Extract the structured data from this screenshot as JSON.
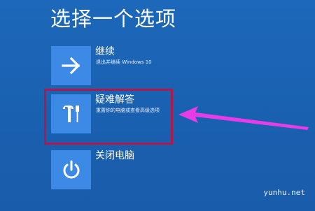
{
  "page": {
    "title": "选择一个选项"
  },
  "options": [
    {
      "label": "继续",
      "description": "退出并继续 Windows 10",
      "icon": "arrow-right-icon"
    },
    {
      "label": "疑难解答",
      "description": "重置你的电脑或查看高级选项",
      "icon": "tools-icon"
    },
    {
      "label": "关闭电脑",
      "description": "",
      "icon": "power-icon"
    }
  ],
  "annotation": {
    "highlight_color": "#b0174a",
    "arrow_color": "#e83ce8"
  },
  "watermark": "yunhu.net",
  "colors": {
    "background": "#1a62b3",
    "tile": "#3d8ae6"
  }
}
